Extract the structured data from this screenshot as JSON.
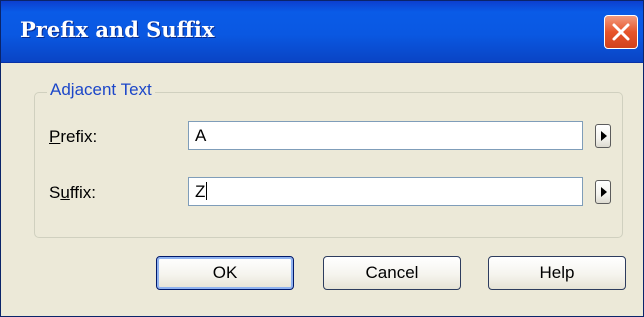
{
  "window": {
    "title": "Prefix and Suffix"
  },
  "group": {
    "legend": "Adjacent Text"
  },
  "fields": {
    "prefix": {
      "label_underlined": "P",
      "label_rest": "refix:",
      "value": "A"
    },
    "suffix": {
      "label_first": "S",
      "label_underlined": "u",
      "label_rest": "ffix:",
      "value": "Z"
    }
  },
  "buttons": {
    "ok": "OK",
    "cancel": "Cancel",
    "help": "Help"
  },
  "icons": {
    "close": "close-icon",
    "arrow": "triangle-right-icon"
  },
  "colors": {
    "titlebar": "#0a58e2",
    "close_button": "#e7552b",
    "groupbox_legend": "#1c47c9",
    "dialog_background": "#ece9d8"
  }
}
